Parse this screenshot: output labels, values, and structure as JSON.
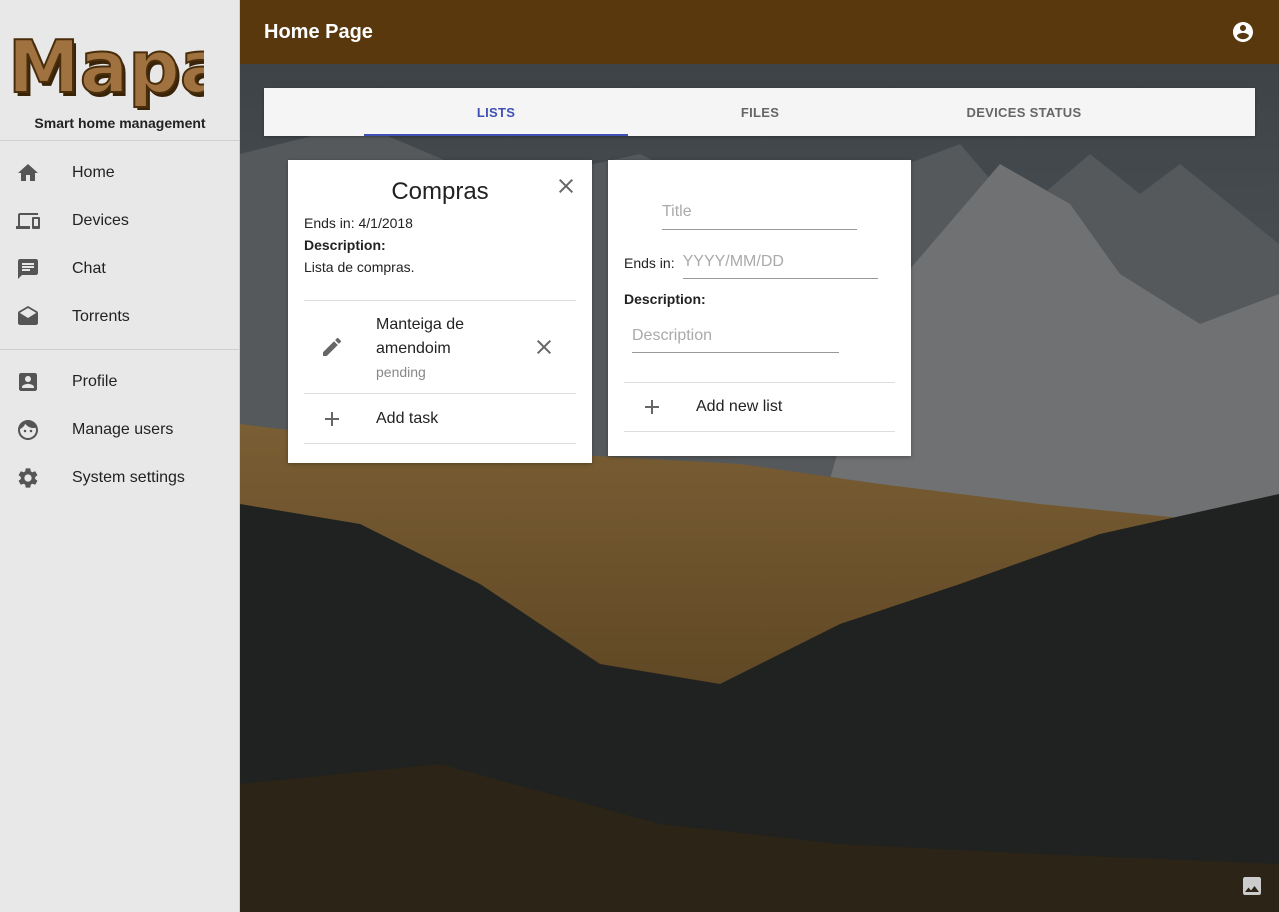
{
  "app": {
    "logo_text": "Mapa",
    "tagline": "Smart home management"
  },
  "sidebar": {
    "primary": [
      {
        "label": "Home",
        "icon": "home-icon"
      },
      {
        "label": "Devices",
        "icon": "devices-icon"
      },
      {
        "label": "Chat",
        "icon": "chat-icon"
      },
      {
        "label": "Torrents",
        "icon": "mail-open-icon"
      }
    ],
    "secondary": [
      {
        "label": "Profile",
        "icon": "profile-icon"
      },
      {
        "label": "Manage users",
        "icon": "face-icon"
      },
      {
        "label": "System settings",
        "icon": "gear-icon"
      }
    ]
  },
  "header": {
    "title": "Home Page",
    "account_icon": "account-circle-icon"
  },
  "tabs": [
    {
      "label": "LISTS",
      "active": true
    },
    {
      "label": "FILES",
      "active": false
    },
    {
      "label": "DEVICES STATUS",
      "active": false
    }
  ],
  "list_card": {
    "title": "Compras",
    "ends_in": "Ends in: 4/1/2018",
    "description_label": "Description:",
    "description": "Lista de compras.",
    "tasks": [
      {
        "name": "Manteiga de amendoim",
        "status": "pending"
      }
    ],
    "add_task_label": "Add task"
  },
  "new_list_card": {
    "title_placeholder": "Title",
    "ends_label": "Ends in:",
    "ends_placeholder": "YYYY/MM/DD",
    "description_label": "Description:",
    "description_placeholder": "Description",
    "add_label": "Add new list"
  },
  "colors": {
    "topbar": "#5a380e",
    "accent": "#3f51b5",
    "sidebar_bg": "#e8e8e8",
    "logo_fill": "#a0723f"
  }
}
